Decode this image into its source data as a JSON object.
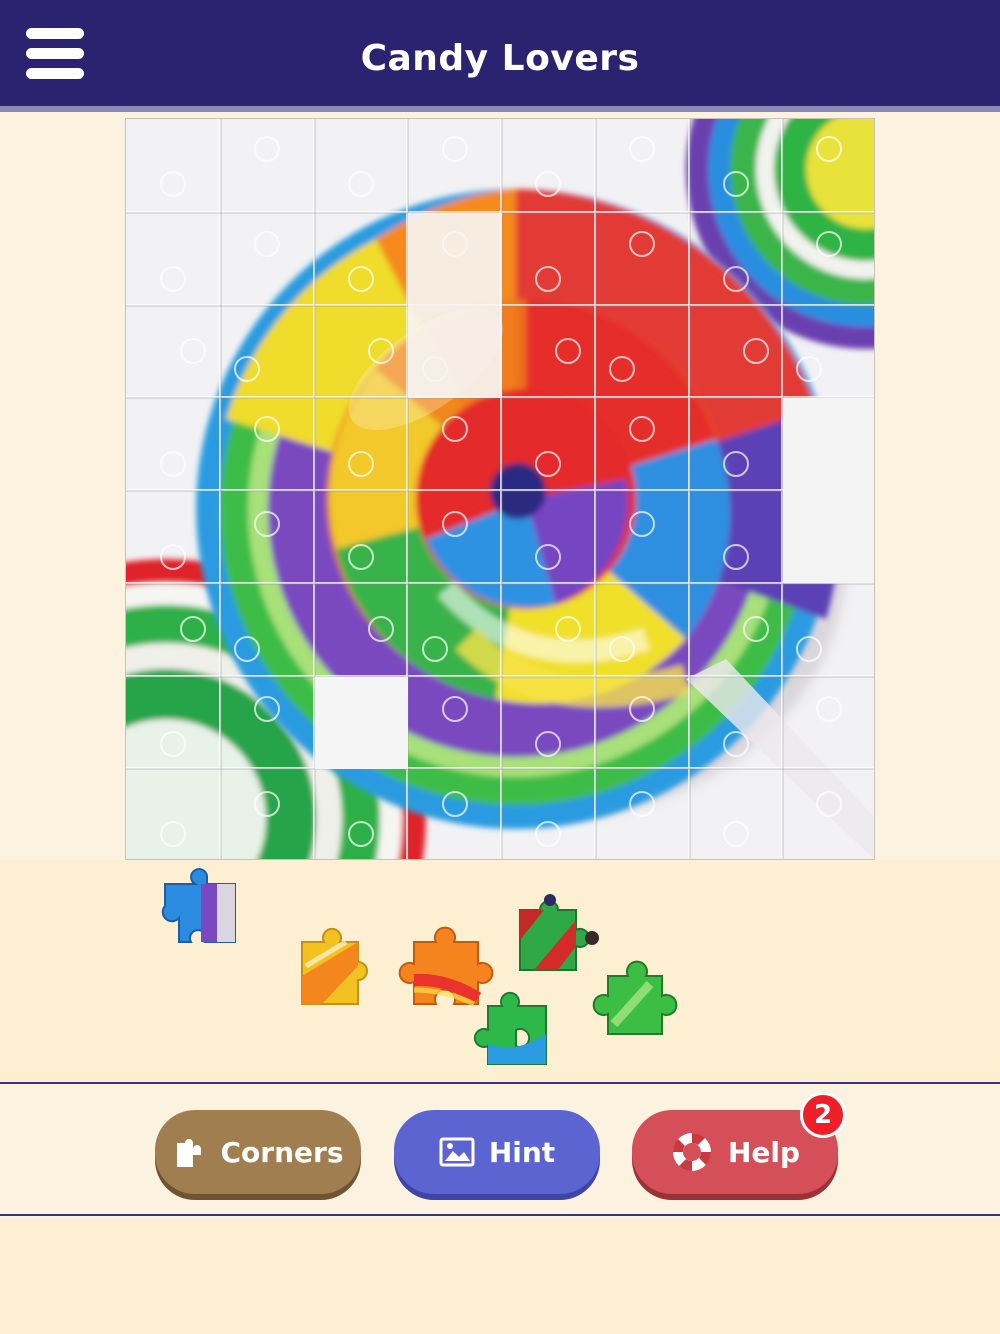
{
  "header": {
    "title": "Candy Lovers",
    "menu_icon": "hamburger-menu-icon"
  },
  "puzzle": {
    "grid_cols": 8,
    "grid_rows": 8,
    "missing_pieces": 6,
    "tray_pieces": 7
  },
  "toolbar": {
    "corners_label": "Corners",
    "corners_icon": "puzzle-corner-icon",
    "hint_label": "Hint",
    "hint_icon": "image-icon",
    "help_label": "Help",
    "help_icon": "lifebuoy-icon",
    "help_badge": "2"
  },
  "colors": {
    "header_bg": "#2c2370",
    "corners_btn": "#a07e50",
    "hint_btn": "#5c64d2",
    "help_btn": "#d44f57",
    "badge": "#ee1f28"
  }
}
